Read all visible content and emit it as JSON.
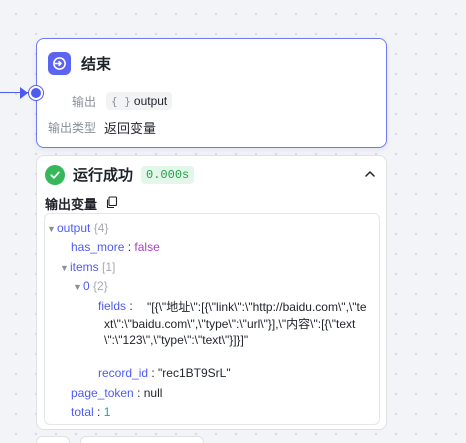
{
  "node": {
    "title": "结束",
    "output_label": "输出",
    "output_value": "output",
    "output_type_label": "输出类型",
    "output_type_value": "返回变量"
  },
  "run": {
    "status": "运行成功",
    "duration": "0.000s",
    "output_var_label": "输出变量"
  },
  "tree": {
    "output_key": "output",
    "output_count": "{4}",
    "has_more_key": "has_more",
    "has_more_val": "false",
    "items_key": "items",
    "items_count": "[1]",
    "idx_key": "0",
    "idx_count": "{2}",
    "fields_key": "fields",
    "fields_val": "\"[{\\\"地址\\\":[{\\\"link\\\":\\\"http://baidu.com\\\",\\\"text\\\":\\\"baidu.com\\\",\\\"type\\\":\\\"url\\\"}],\\\"内容\\\":[{\\\"text\\\":\\\"123\\\",\\\"type\\\":\\\"text\\\"}]}]\"",
    "record_id_key": "record_id",
    "record_id_val": "\"rec1BT9SrL\"",
    "page_token_key": "page_token",
    "page_token_val": "null",
    "total_key": "total",
    "total_val": "1"
  },
  "colors": {
    "accent": "#4e5bf0",
    "success": "#34b85a",
    "key": "#4e5bf0"
  },
  "icons": {
    "node": "end-node-icon",
    "status": "check-circle-icon",
    "copy": "copy-icon",
    "collapse": "chevron-up-icon"
  }
}
